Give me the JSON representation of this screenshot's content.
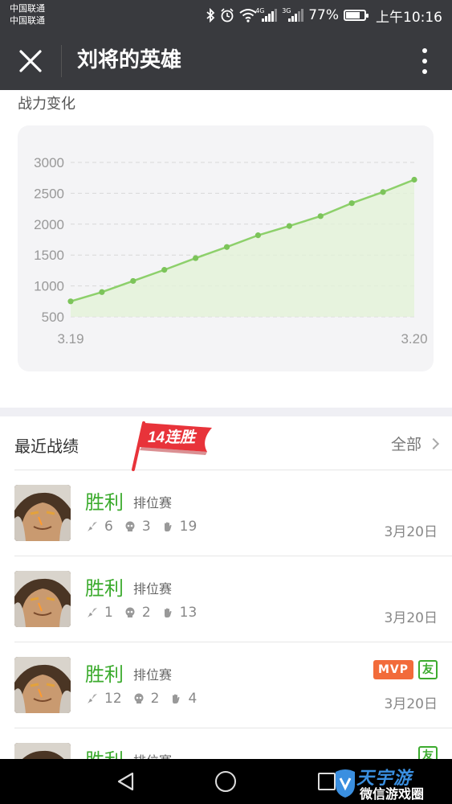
{
  "status_bar": {
    "carrier_1": "中国联通",
    "carrier_2": "中国联通",
    "net_1": "4G",
    "net_2": "3G",
    "battery": "77%",
    "battery_level": 0.77,
    "time": "上午10:16"
  },
  "header": {
    "title": "刘将的英雄",
    "icons": [
      "close-icon",
      "more-vertical-icon"
    ]
  },
  "chart_section": {
    "title": "战力变化"
  },
  "chart_data": {
    "type": "area",
    "title": "战力变化",
    "x_tick_labels": [
      "3.19",
      "3.20"
    ],
    "y_ticks": [
      500,
      1000,
      1500,
      2000,
      2500,
      3000
    ],
    "ylim": [
      500,
      3000
    ],
    "grid": true,
    "series": [
      {
        "values": [
          750,
          900,
          1080,
          1260,
          1450,
          1630,
          1820,
          1970,
          2130,
          2340,
          2520,
          2720
        ]
      }
    ],
    "colors": {
      "line": "#8dd06b",
      "fill": "#e3f3d8",
      "point": "#7cc45a",
      "grid": "#d8d8d8",
      "tick": "#999999"
    }
  },
  "recent_records": {
    "title": "最近战绩",
    "streak_label": "14连胜",
    "view_all": "全部",
    "matches": [
      {
        "result": "胜利",
        "mode": "排位赛",
        "kills": "6",
        "deaths": "3",
        "assists": "19",
        "date": "3月20日",
        "mvp": "",
        "friend": ""
      },
      {
        "result": "胜利",
        "mode": "排位赛",
        "kills": "1",
        "deaths": "2",
        "assists": "13",
        "date": "3月20日",
        "mvp": "",
        "friend": ""
      },
      {
        "result": "胜利",
        "mode": "排位赛",
        "kills": "12",
        "deaths": "2",
        "assists": "4",
        "date": "3月20日",
        "mvp": "MVP",
        "friend": "友"
      },
      {
        "result": "胜利",
        "mode": "排位赛",
        "kills": "",
        "deaths": "",
        "assists": "",
        "date": "",
        "mvp": "",
        "friend": "友"
      }
    ]
  },
  "nav_bar": {
    "icons": [
      "back-triangle-icon",
      "home-circle-icon",
      "recent-apps-icon"
    ]
  },
  "watermark": {
    "brand": "天宇游",
    "text": "微信游戏圈"
  },
  "colors": {
    "header_bg": "#393a3e",
    "win_green": "#3cab2e",
    "mvp_orange": "#f26b3a",
    "streak_red": "#e8333a"
  }
}
